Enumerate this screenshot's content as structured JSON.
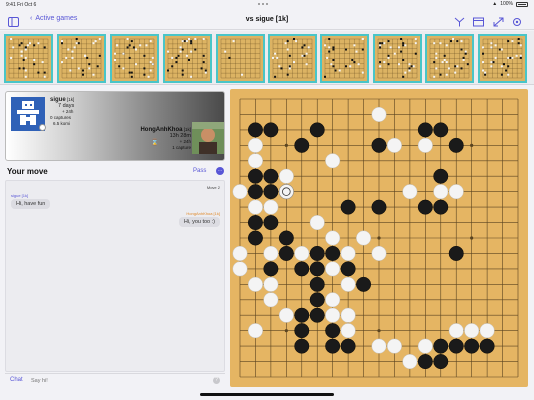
{
  "status": {
    "time": "9:41",
    "date": "Fri Oct 6",
    "battery": "100%"
  },
  "nav": {
    "back_label": "Active games",
    "title": "vs sigue [1k]"
  },
  "player_top": {
    "name": "sigue",
    "rank": "[1k]",
    "time_main": "7 days",
    "time_extra": "+ 24h",
    "captures": "0 captures",
    "komi": "6.5 komi"
  },
  "player_bottom": {
    "name": "HongAnhKhoa",
    "rank": "[1k]",
    "time_main": "13h 28m",
    "time_extra": "+ 24h",
    "captures": "1 capture"
  },
  "move_panel": {
    "your_move": "Your move",
    "pass_label": "Pass",
    "move_counter": "Move 2"
  },
  "chat": {
    "messages": [
      {
        "author": "sigue [1k]",
        "text": "Hi, have fun",
        "side": "left"
      },
      {
        "author": "HongAnhKhoa [1k]",
        "text": "Hi, you too :)",
        "side": "right"
      }
    ],
    "tab_label": "Chat",
    "placeholder": "Say hi!",
    "help_glyph": "?"
  },
  "board": {
    "size": 19,
    "colors": {
      "wood": "#e5b563",
      "line": "#5a4420",
      "black": "#1a1a1a",
      "white": "#f4f4f4"
    },
    "black_stones": [
      [
        1,
        2
      ],
      [
        2,
        2
      ],
      [
        5,
        2
      ],
      [
        12,
        2
      ],
      [
        13,
        2
      ],
      [
        4,
        3
      ],
      [
        9,
        3
      ],
      [
        14,
        3
      ],
      [
        1,
        5
      ],
      [
        2,
        5
      ],
      [
        13,
        5
      ],
      [
        1,
        6
      ],
      [
        2,
        6
      ],
      [
        7,
        7
      ],
      [
        9,
        7
      ],
      [
        12,
        7
      ],
      [
        13,
        7
      ],
      [
        1,
        8
      ],
      [
        2,
        8
      ],
      [
        1,
        9
      ],
      [
        3,
        9
      ],
      [
        3,
        10
      ],
      [
        5,
        10
      ],
      [
        6,
        10
      ],
      [
        4,
        11
      ],
      [
        2,
        11
      ],
      [
        14,
        10
      ],
      [
        5,
        12
      ],
      [
        5,
        13
      ],
      [
        4,
        14
      ],
      [
        5,
        14
      ],
      [
        6,
        15
      ],
      [
        4,
        15
      ],
      [
        13,
        16
      ],
      [
        4,
        16
      ],
      [
        6,
        16
      ],
      [
        7,
        16
      ],
      [
        13,
        17
      ],
      [
        14,
        16
      ],
      [
        15,
        16
      ],
      [
        16,
        16
      ],
      [
        12,
        17
      ],
      [
        7,
        11
      ],
      [
        8,
        12
      ],
      [
        5,
        11
      ]
    ],
    "white_stones": [
      [
        9,
        1
      ],
      [
        12,
        2
      ],
      [
        12,
        3
      ],
      [
        1,
        3
      ],
      [
        6,
        4
      ],
      [
        1,
        4
      ],
      [
        3,
        5
      ],
      [
        11,
        6
      ],
      [
        13,
        6
      ],
      [
        0,
        6
      ],
      [
        1,
        7
      ],
      [
        2,
        7
      ],
      [
        5,
        8
      ],
      [
        6,
        9
      ],
      [
        8,
        9
      ],
      [
        0,
        10
      ],
      [
        2,
        10
      ],
      [
        0,
        11
      ],
      [
        4,
        10
      ],
      [
        7,
        10
      ],
      [
        2,
        12
      ],
      [
        6,
        11
      ],
      [
        9,
        10
      ],
      [
        1,
        12
      ],
      [
        3,
        10
      ],
      [
        5,
        13
      ],
      [
        6,
        13
      ],
      [
        7,
        12
      ],
      [
        6,
        14
      ],
      [
        7,
        14
      ],
      [
        7,
        15
      ],
      [
        1,
        15
      ],
      [
        9,
        16
      ],
      [
        10,
        16
      ],
      [
        11,
        17
      ],
      [
        12,
        16
      ],
      [
        14,
        15
      ],
      [
        15,
        15
      ],
      [
        16,
        15
      ],
      [
        3,
        14
      ],
      [
        2,
        13
      ],
      [
        14,
        6
      ],
      [
        10,
        3
      ]
    ],
    "last_move": [
      3,
      6
    ]
  }
}
